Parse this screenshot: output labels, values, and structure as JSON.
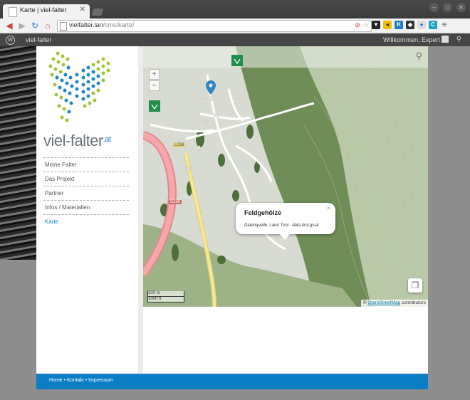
{
  "browser": {
    "tab_title": "Karte | viel-falter",
    "url_host": "vielfalter.lan",
    "url_path": "/cms/karte/"
  },
  "wp_admin": {
    "site_name": "viel-falter",
    "welcome": "Willkommen, Expert"
  },
  "site": {
    "logo_text": "viel-falter",
    "logo_suffix": ".at",
    "menu": [
      "Meine Falter",
      "Das Projekt",
      "Partner",
      "Infos / Materialien",
      "Karte"
    ],
    "active_menu": "Karte"
  },
  "map": {
    "popup_title": "Feldgehölze",
    "popup_source": "Datenquelle: Land Tirol - data.tirol.gv.at",
    "scale_m": "300 m",
    "scale_ft": "1000 ft",
    "attribution_prefix": "©",
    "attribution_link": "OpenStreetMap",
    "attribution_suffix": "contributors",
    "road_labels": [
      "B186",
      "L238"
    ]
  },
  "footer": {
    "links": "Home • Kontakt • Impressum"
  },
  "colors": {
    "brand_blue": "#0a7dc4",
    "forest": "#6e8d55",
    "road_red": "#e9868a",
    "road_yellow": "#f2e28a"
  }
}
